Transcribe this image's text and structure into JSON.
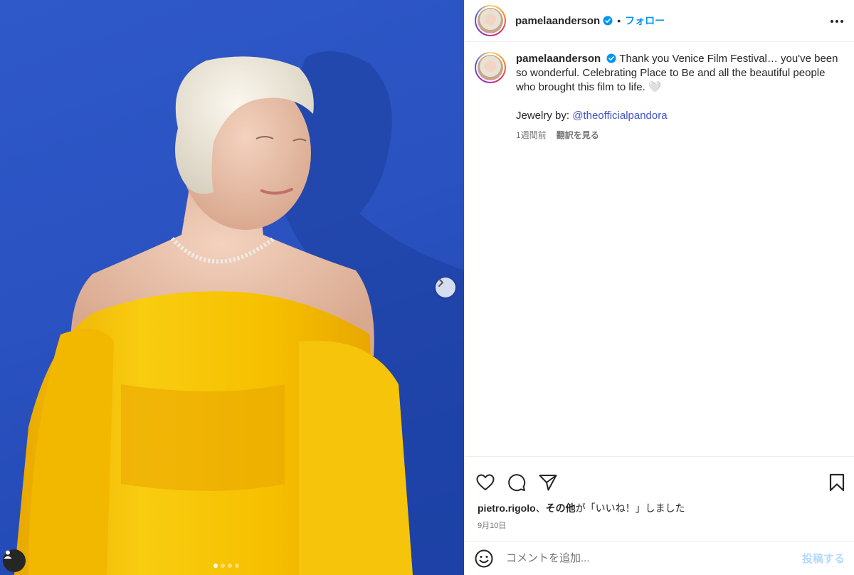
{
  "post": {
    "username": "pamelaanderson",
    "follow_label": "フォロー",
    "separator": "•",
    "carousel": {
      "slide_count": 4,
      "current_slide": 1
    }
  },
  "caption": {
    "username": "pamelaanderson",
    "text": "Thank you Venice Film Festival… you've been so wonderful. Celebrating Place to Be and all the beautiful people who brought this film to life. 🤍",
    "jewelry_label": "Jewelry by: ",
    "jewelry_mention": "@theofficialpandora",
    "time_ago": "1週間前",
    "translate_label": "翻訳を見る"
  },
  "engagement": {
    "liked_by_user": "pietro.rigolo",
    "liked_by_sep": "、",
    "others_label": "その他",
    "liked_suffix": "が「いいね！」しました",
    "date": "9月10日"
  },
  "comment": {
    "placeholder": "コメントを追加...",
    "post_label": "投稿する"
  },
  "colors": {
    "accent": "#0095f6",
    "mention": "#4254c7",
    "background_blue": "#2a52c0",
    "dress_yellow": "#f7c20f"
  }
}
